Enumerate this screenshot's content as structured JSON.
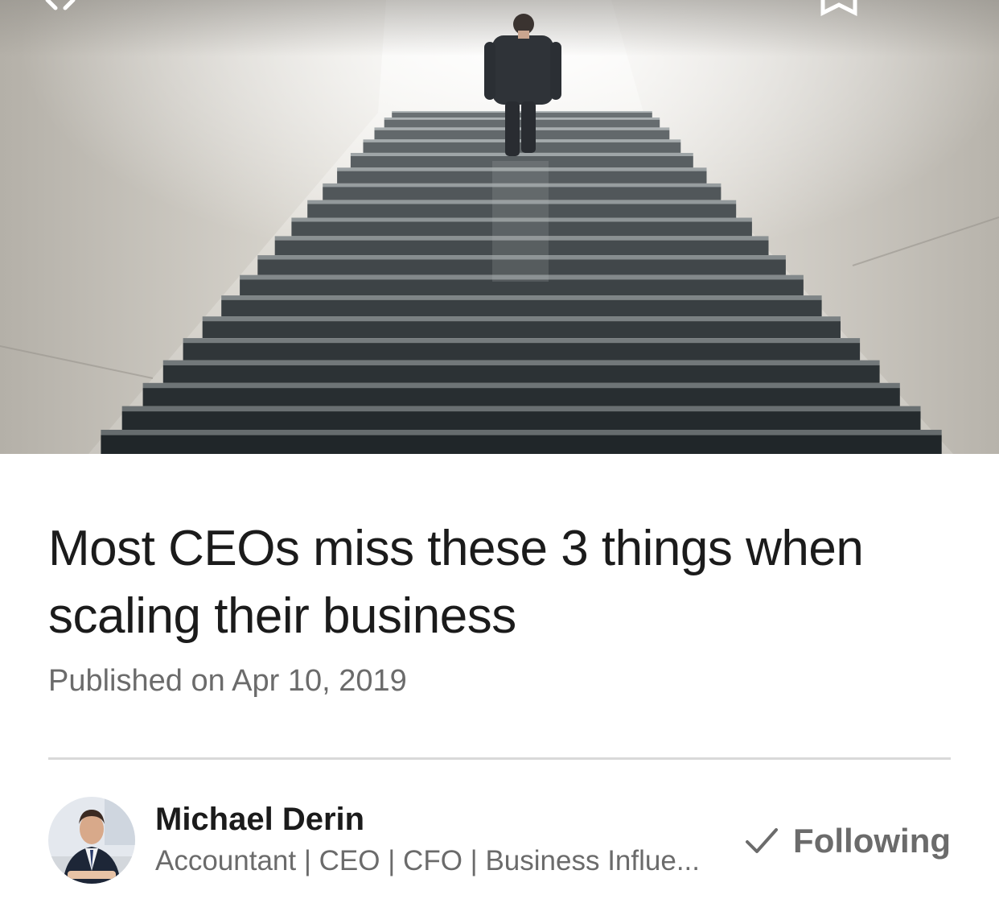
{
  "article": {
    "title": "Most CEOs miss these 3 things when scaling their business",
    "published": "Published on Apr 10, 2019"
  },
  "hero": {
    "icons": {
      "close": "close-icon",
      "bookmark": "bookmark-icon"
    }
  },
  "author": {
    "name": "Michael Derin",
    "headline": "Accountant | CEO | CFO | Business Influe...",
    "follow_label": "Following",
    "follow_icon": "checkmark-icon"
  },
  "colors": {
    "text_primary": "#1b1b1b",
    "text_secondary": "#6b6b6b",
    "divider": "#d9d9d9"
  }
}
